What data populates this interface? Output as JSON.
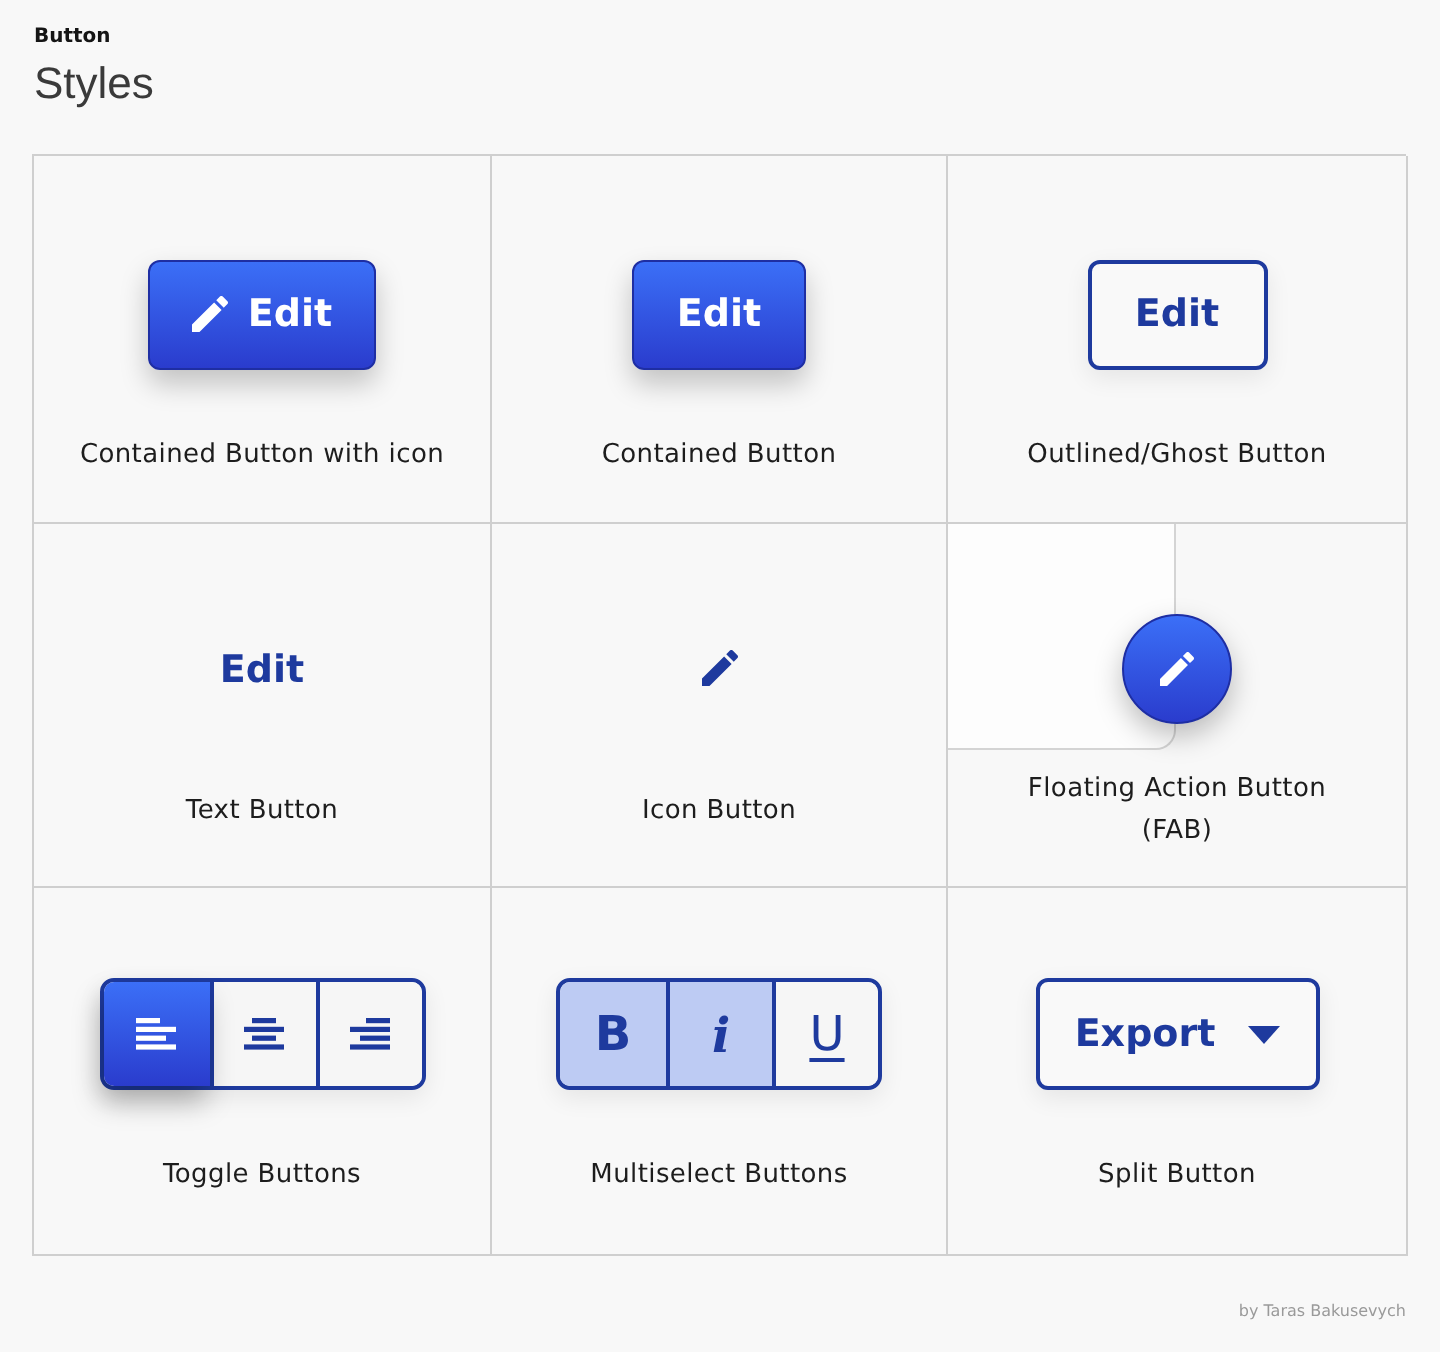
{
  "header": {
    "eyebrow": "Button",
    "title": "Styles"
  },
  "cells": [
    {
      "kind": "contained",
      "leading_icon": true,
      "label": "Edit",
      "caption": "Contained Button with icon"
    },
    {
      "kind": "contained",
      "leading_icon": false,
      "label": "Edit",
      "caption": "Contained Button"
    },
    {
      "kind": "outlined",
      "label": "Edit",
      "caption": "Outlined/Ghost Button"
    },
    {
      "kind": "text",
      "label": "Edit",
      "caption": "Text Button"
    },
    {
      "kind": "icon",
      "caption": "Icon Button"
    },
    {
      "kind": "fab",
      "caption": "Floating Action Button (FAB)"
    },
    {
      "kind": "toggle",
      "caption": "Toggle Buttons",
      "options": [
        {
          "selected": true
        },
        {
          "selected": false
        },
        {
          "selected": false
        }
      ]
    },
    {
      "kind": "multiselect",
      "caption": "Multiselect Buttons",
      "options": [
        {
          "kind": "bold",
          "label": "B",
          "selected": true
        },
        {
          "kind": "italic",
          "label": "i",
          "selected": true
        },
        {
          "kind": "underline",
          "label": "U",
          "selected": false
        }
      ]
    },
    {
      "kind": "split",
      "label": "Export",
      "caption": "Split Button"
    }
  ],
  "credit": "by Taras Bakusevych"
}
